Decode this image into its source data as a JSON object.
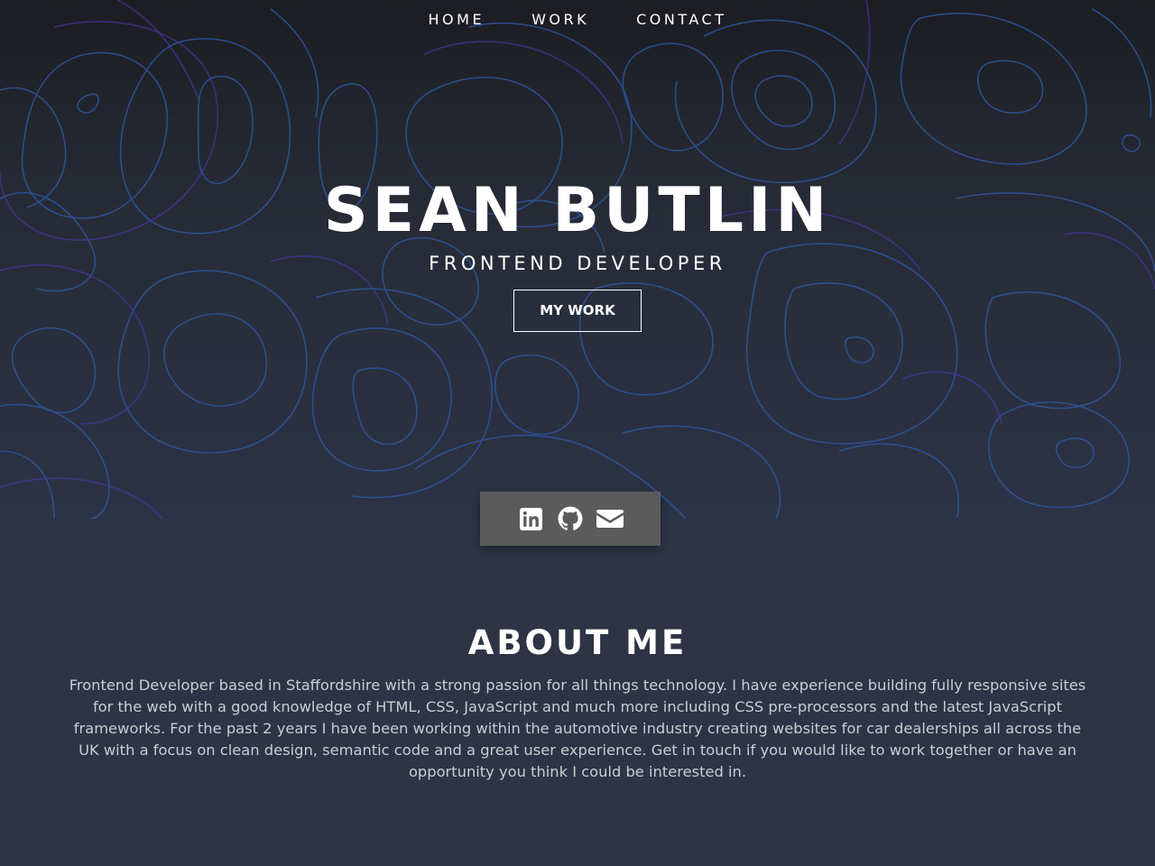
{
  "nav": {
    "items": [
      {
        "label": "HOME"
      },
      {
        "label": "WORK"
      },
      {
        "label": "CONTACT"
      }
    ]
  },
  "hero": {
    "title": "SEAN BUTLIN",
    "subtitle": "FRONTEND DEVELOPER",
    "cta_label": "MY WORK"
  },
  "social": {
    "icons": [
      "linkedin-icon",
      "github-icon",
      "envelope-icon"
    ]
  },
  "about": {
    "title": "ABOUT ME",
    "text": "Frontend Developer based in Staffordshire with a strong passion for all things technology. I have experience building fully responsive sites for the web with a good knowledge of HTML, CSS, JavaScript and much more including CSS pre-processors and the latest JavaScript frameworks. For the past 2 years I have been working within the automotive industry creating websites for car dealerships all across the UK with a focus on clean design, semantic code and a great user experience. Get in touch if you would like to work together or have an opportunity you think I could be interested in."
  },
  "colors": {
    "page_background": "#2e3445",
    "contour_blue": "#2f5aa8",
    "contour_purple": "#4a36a8",
    "social_box": "#5b5b5b",
    "text_primary": "#ffffff",
    "text_body": "#c9ccd3"
  }
}
